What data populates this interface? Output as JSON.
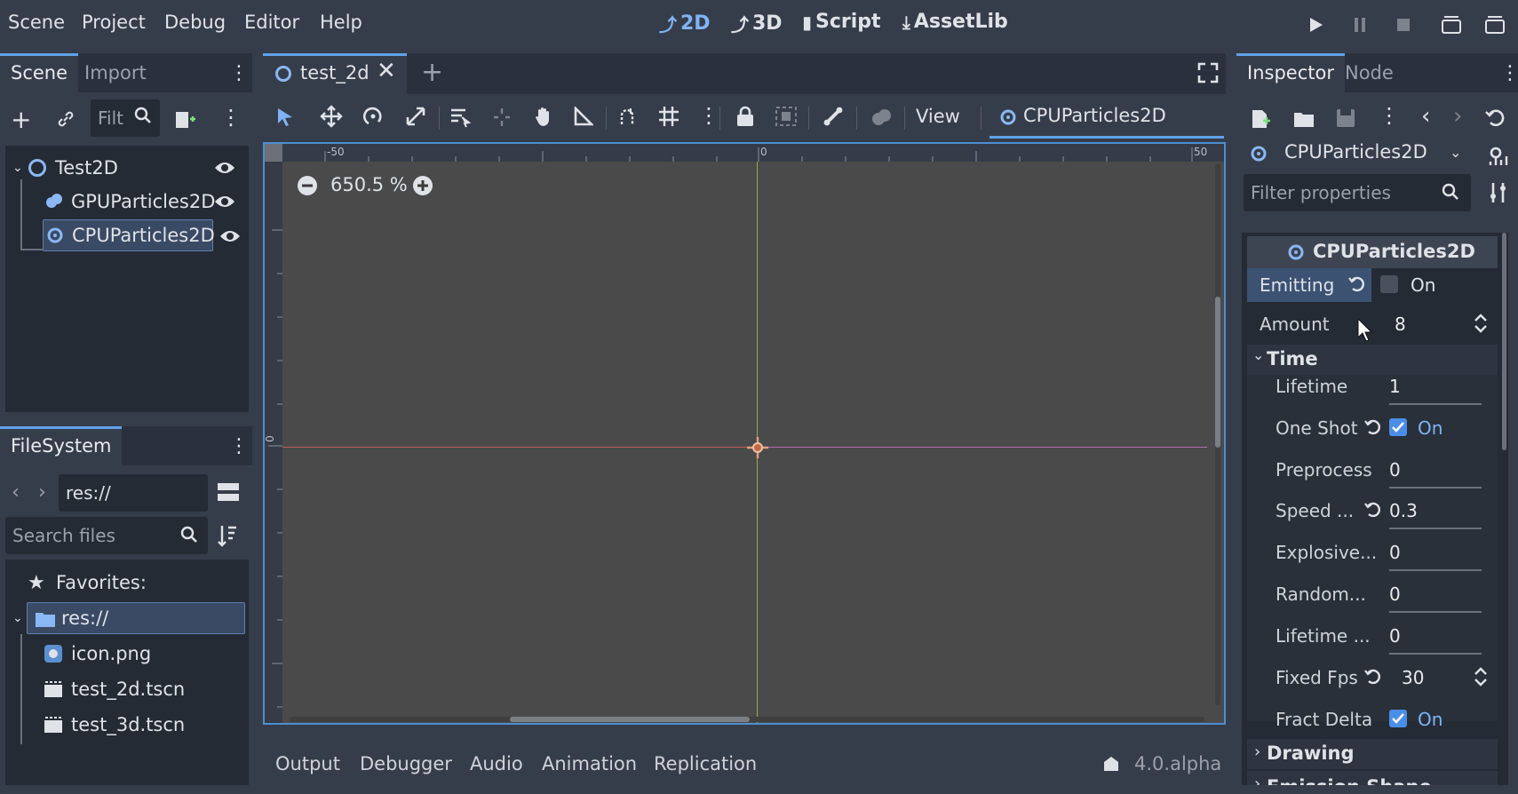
{
  "menu": [
    "Scene",
    "Project",
    "Debug",
    "Editor",
    "Help"
  ],
  "workspaces": {
    "w2d": "2D",
    "w3d": "3D",
    "script": "Script",
    "assetlib": "AssetLib"
  },
  "scene_dock": {
    "tabs": [
      "Scene",
      "Import"
    ],
    "filter_placeholder": "Filt",
    "tree": [
      {
        "label": "Test2D",
        "icon": "node2d-icon"
      },
      {
        "label": "GPUParticles2D",
        "icon": "gpu-particles-icon"
      },
      {
        "label": "CPUParticles2D",
        "icon": "cpu-particles-icon"
      }
    ]
  },
  "filesystem": {
    "tab": "FileSystem",
    "path": "res://",
    "search_placeholder": "Search files",
    "favorites": "Favorites:",
    "root": "res://",
    "files": [
      "icon.png",
      "test_2d.tscn",
      "test_3d.tscn"
    ]
  },
  "editor": {
    "scene_tab": "test_2d",
    "zoom": "650.5 %",
    "view_menu": "View",
    "selected_node_button": "CPUParticles2D",
    "ruler": {
      "neg": "-50",
      "zero": "0",
      "pos": "50",
      "vzero": "0"
    }
  },
  "bottom": {
    "tabs": [
      "Output",
      "Debugger",
      "Audio",
      "Animation",
      "Replication"
    ],
    "version": "4.0.alpha"
  },
  "inspector": {
    "tabs": [
      "Inspector",
      "Node"
    ],
    "object": "CPUParticles2D",
    "filter_placeholder": "Filter properties",
    "header": "CPUParticles2D",
    "emitting": {
      "label": "Emitting",
      "value": "On",
      "checked": false
    },
    "amount": {
      "label": "Amount",
      "value": "8"
    },
    "time_section": "Time",
    "time_props": [
      {
        "label": "Lifetime",
        "value": "1",
        "kind": "slider"
      },
      {
        "label": "One Shot",
        "value": "On",
        "kind": "check"
      },
      {
        "label": "Preprocess",
        "value": "0",
        "kind": "slider"
      },
      {
        "label": "Speed ...",
        "value": "0.3",
        "kind": "slider"
      },
      {
        "label": "Explosive...",
        "value": "0",
        "kind": "slider"
      },
      {
        "label": "Random...",
        "value": "0",
        "kind": "slider"
      },
      {
        "label": "Lifetime ...",
        "value": "0",
        "kind": "slider"
      },
      {
        "label": "Fixed Fps",
        "value": "30",
        "kind": "spin"
      },
      {
        "label": "Fract Delta",
        "value": "On",
        "kind": "check"
      }
    ],
    "drawing_section": "Drawing",
    "next_section": "Emission Shape"
  },
  "colors": {
    "accent": "#4b8ee7",
    "panel": "#252b35",
    "bg": "#363d4a",
    "viewport": "#4a4a4a"
  }
}
